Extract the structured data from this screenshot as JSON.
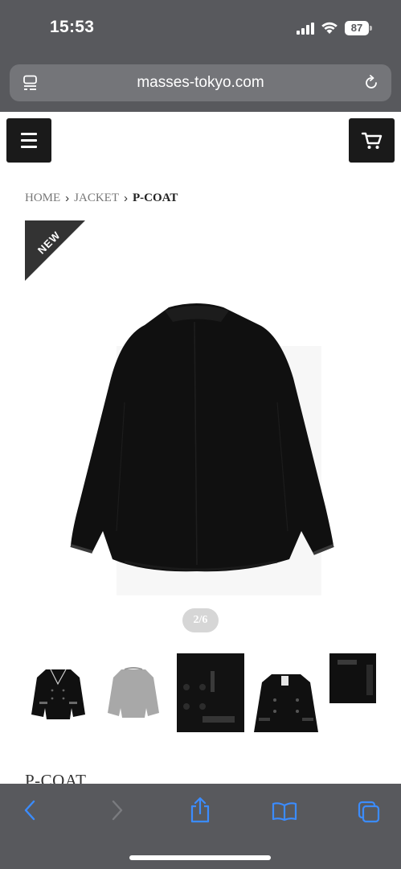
{
  "status_bar": {
    "time": "15:53",
    "battery": "87",
    "icons": [
      "signal-icon",
      "wifi-icon",
      "battery-icon"
    ]
  },
  "browser": {
    "url": "masses-tokyo.com",
    "icons": [
      "tabs-overview-icon",
      "reload-icon"
    ]
  },
  "header": {
    "icons": [
      "hamburger-menu-icon",
      "cart-icon"
    ]
  },
  "breadcrumb": {
    "items": [
      "HOME",
      "JACKET",
      "P-COAT"
    ]
  },
  "product": {
    "badge": "NEW",
    "pager": "2/6",
    "title": "P-COAT",
    "thumbnail_count": 5,
    "colors": {
      "coat": "#101010",
      "trim": "#2a2a2a",
      "gray_variant": "#a8a8a8"
    }
  },
  "toolbar": {
    "icons": [
      "back-icon",
      "forward-icon",
      "share-icon",
      "bookmarks-icon",
      "tabs-icon"
    ],
    "accent": "#3b8cff"
  }
}
